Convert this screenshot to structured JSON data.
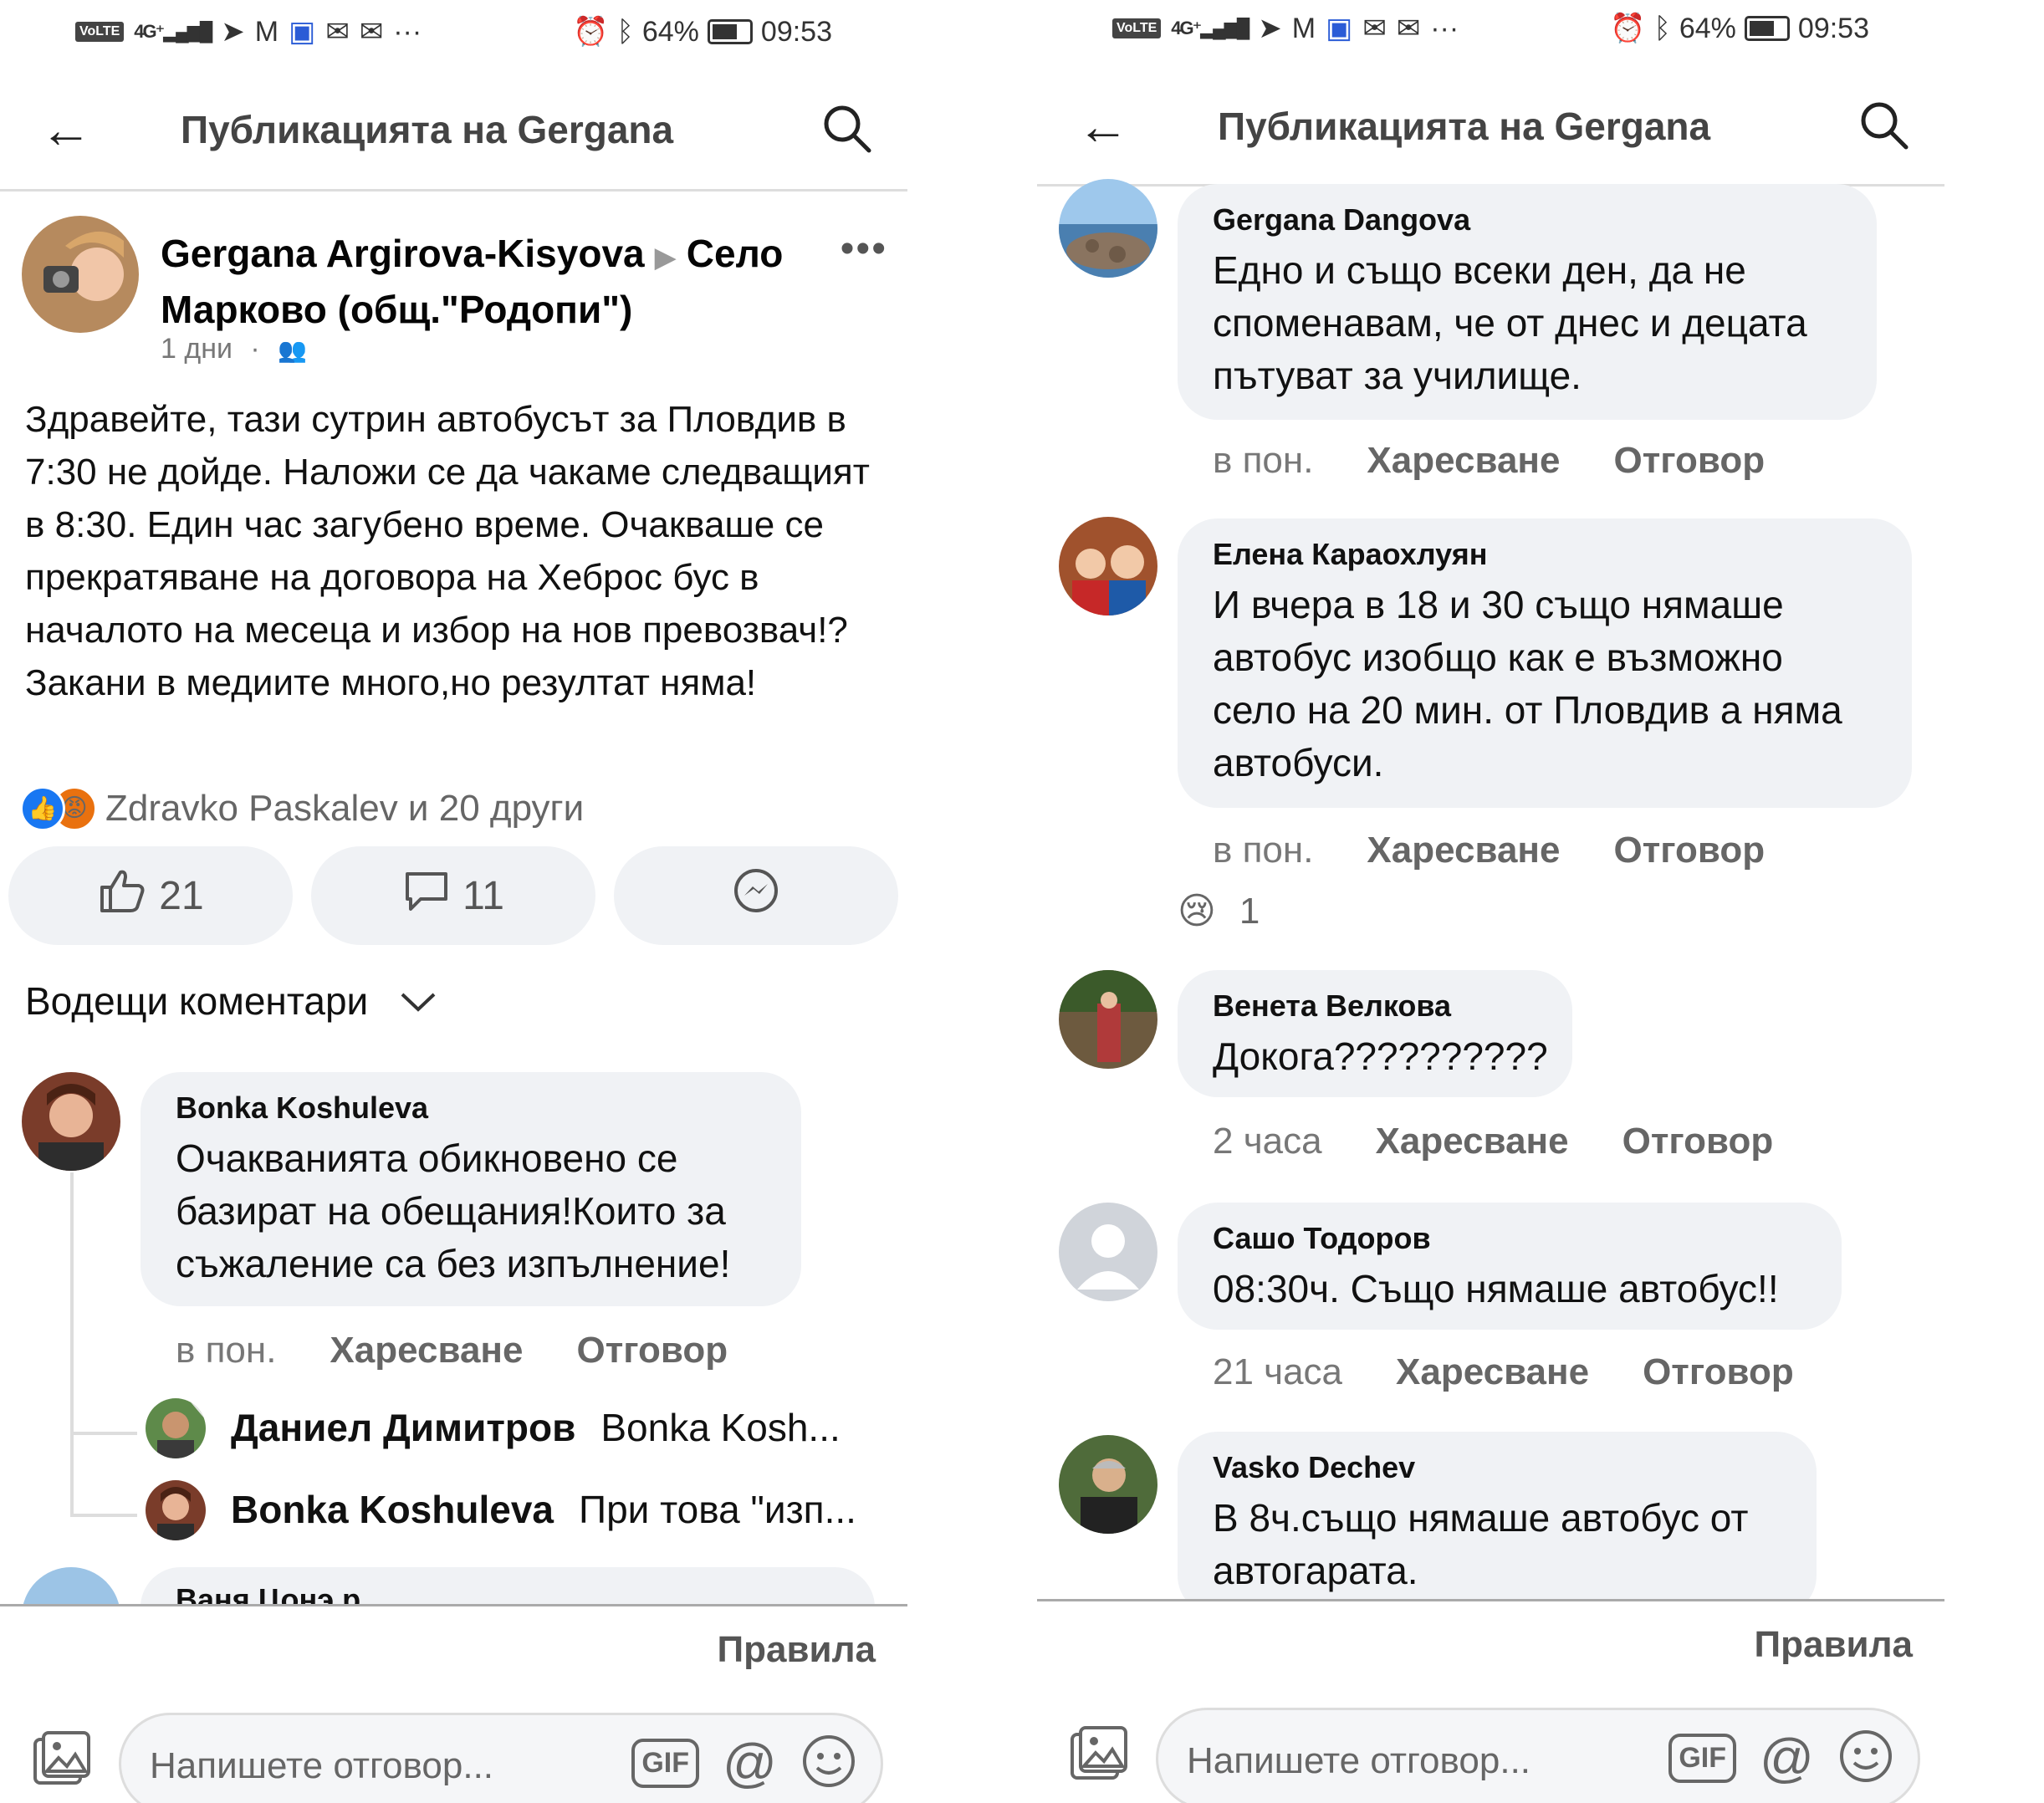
{
  "status": {
    "battery": "64%",
    "time": "09:53",
    "volte": "VoLTE",
    "network": "4G⁺",
    "more": "···"
  },
  "header": {
    "title": "Публикацията на Gergana"
  },
  "post": {
    "author": "Gergana Argirova-Kisyova",
    "target": "Село Марково (общ.\"Родопи\")",
    "time": "1 дни",
    "dot": "·",
    "text": "Здравейте, тази сутрин автобусът за Пловдив в 7:30 не дойде. Наложи се да чакаме следващият в 8:30. Един час загубено време. Очакваше се прекратяване на договора на Хеброс бус в началото на месеца и избор на нов превозвач!? Закани в медиите много,но резултат няма!",
    "reactions_summary": "Zdravko Paskalev и 20 други",
    "like_count": "21",
    "comment_count": "11"
  },
  "sort_label": "Водещи коментари",
  "comments_left": [
    {
      "name": "Bonka Koshuleva",
      "text": "Очакванията обикновено се базират на обещания!Които за съжаление са без изпълнение!",
      "time": "в пон."
    }
  ],
  "replies": [
    {
      "name": "Даниел Димитров",
      "text": "Bonka Kosh..."
    },
    {
      "name": "Bonka Koshuleva",
      "text": "При това \"изп..."
    }
  ],
  "partial_name": "Ваня Цонэ р",
  "comments_right": [
    {
      "name": "Gergana Dangova",
      "text": "Едно и също всеки ден, да не споменавам, че от днес и децата пътуват за училище.",
      "time": "в пон."
    },
    {
      "name": "Елена Караохлуян",
      "text": "И вчера в 18 и 30  също нямаше автобус изобщо как е възможно село на 20 мин. от Пловдив а няма автобуси.",
      "time": "в пон.",
      "reaction_count": "1"
    },
    {
      "name": "Венета Велкова",
      "text": "Докога??????????",
      "time": "2 часа"
    },
    {
      "name": "Сашо Тодоров",
      "text": "08:30ч. Също нямаше автобус!!",
      "time": "21 часа"
    },
    {
      "name": "Vasko Dechev",
      "text": "В 8ч.също нямаше автобус от автогарата.",
      "time": ""
    }
  ],
  "actions": {
    "like": "Харесване",
    "reply": "Отговор"
  },
  "footer": {
    "rules": "Правила",
    "placeholder": "Напишете отговор...",
    "gif": "GIF",
    "at": "@"
  }
}
